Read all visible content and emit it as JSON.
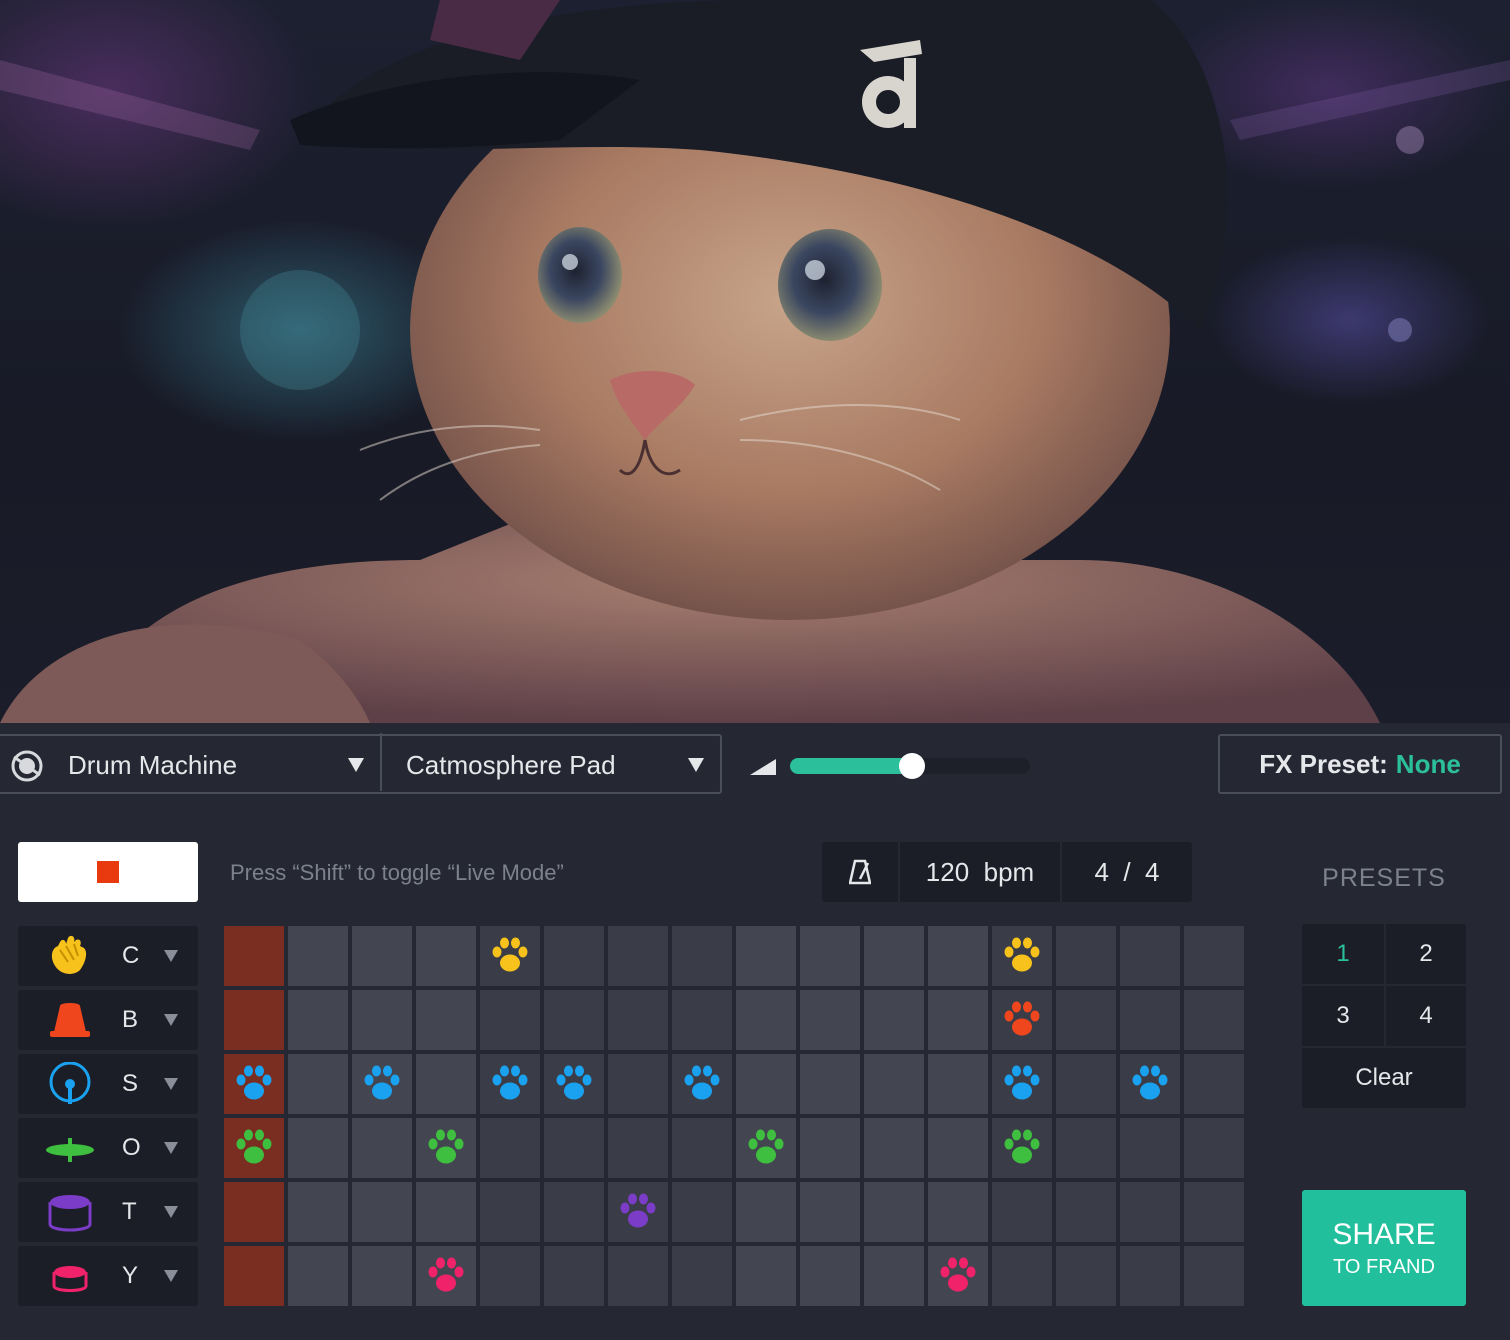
{
  "hero": {
    "alt_subject": "cat-in-cap-image"
  },
  "toolbar": {
    "instrument": "Drum Machine",
    "sound": "Catmosphere Pad",
    "volume": 0.5,
    "fx_label": "FX Preset:",
    "fx_value": "None"
  },
  "transport": {
    "hint": "Press “Shift” to toggle “Live Mode”",
    "tempo": "120  bpm",
    "time_signature": "4  /  4"
  },
  "colors": {
    "accent": "#2bbf9c",
    "stop": "#e83a0e",
    "step_on": "#7a2e22",
    "clap": "#f7c21b",
    "bell": "#f0461e",
    "snare": "#1aa2f0",
    "cymbal": "#3fbf40",
    "tom": "#7b3cc8",
    "kick": "#f0236a"
  },
  "tracks": [
    {
      "letter": "C",
      "icon": "clap-icon",
      "color": "#f7c21b",
      "steps": [
        0,
        0,
        0,
        0,
        1,
        0,
        0,
        0,
        0,
        0,
        0,
        0,
        1,
        0,
        0,
        0
      ]
    },
    {
      "letter": "B",
      "icon": "bell-icon",
      "color": "#f0461e",
      "steps": [
        0,
        0,
        0,
        0,
        0,
        0,
        0,
        0,
        0,
        0,
        0,
        0,
        1,
        0,
        0,
        0
      ]
    },
    {
      "letter": "S",
      "icon": "snare-icon",
      "color": "#1aa2f0",
      "steps": [
        1,
        0,
        1,
        0,
        1,
        1,
        0,
        1,
        0,
        0,
        0,
        0,
        1,
        0,
        1,
        0
      ]
    },
    {
      "letter": "O",
      "icon": "cymbal-icon",
      "color": "#3fbf40",
      "steps": [
        1,
        0,
        0,
        1,
        0,
        0,
        0,
        0,
        1,
        0,
        0,
        0,
        1,
        0,
        0,
        0
      ]
    },
    {
      "letter": "T",
      "icon": "tom-icon",
      "color": "#7b3cc8",
      "steps": [
        0,
        0,
        0,
        0,
        0,
        0,
        1,
        0,
        0,
        0,
        0,
        0,
        0,
        0,
        0,
        0
      ]
    },
    {
      "letter": "Y",
      "icon": "kick-icon",
      "color": "#f0236a",
      "steps": [
        0,
        0,
        0,
        1,
        0,
        0,
        0,
        0,
        0,
        0,
        0,
        1,
        0,
        0,
        0,
        0
      ]
    }
  ],
  "playhead_step": 1,
  "presets": {
    "title": "PRESETS",
    "items": [
      "1",
      "2",
      "3",
      "4"
    ],
    "active": "1",
    "clear": "Clear"
  },
  "share": {
    "main": "SHARE",
    "sub": "TO FRAND"
  }
}
